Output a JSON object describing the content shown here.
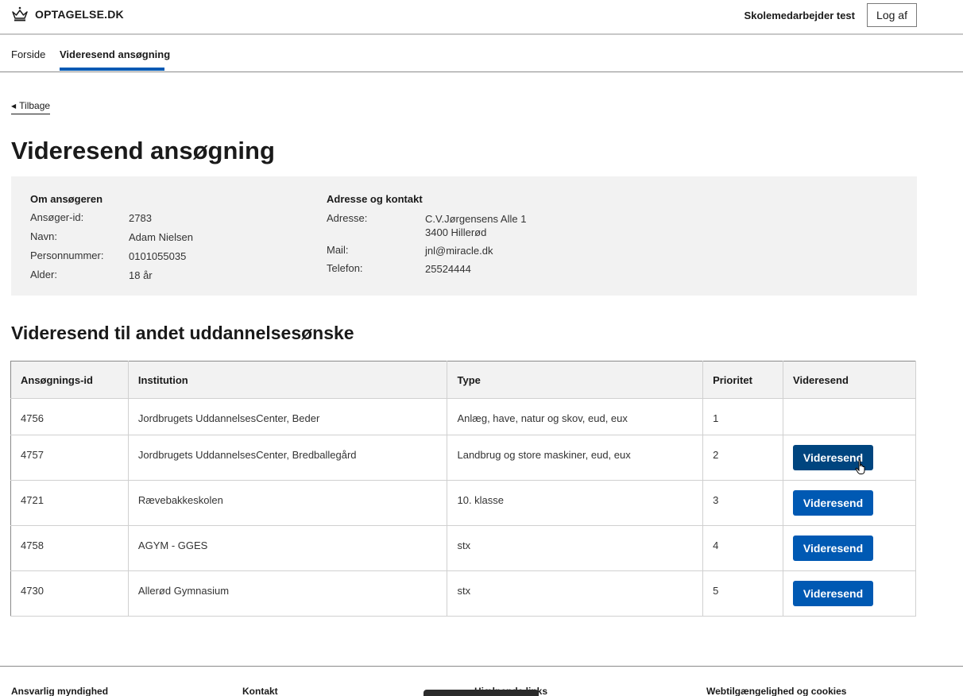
{
  "header": {
    "logo_text": "OPTAGELSE.DK",
    "user_name": "Skolemedarbejder test",
    "logout_label": "Log af"
  },
  "nav": {
    "items": [
      {
        "label": "Forside"
      },
      {
        "label": "Videresend ansøgning"
      }
    ],
    "active_index": 1
  },
  "back_label": "Tilbage",
  "page_title": "Videresend ansøgning",
  "applicant": {
    "heading": "Om ansøgeren",
    "fields": [
      {
        "label": "Ansøger-id:",
        "value": "2783"
      },
      {
        "label": "Navn:",
        "value": "Adam Nielsen"
      },
      {
        "label": "Personnummer:",
        "value": "0101055035"
      },
      {
        "label": "Alder:",
        "value": "18 år"
      }
    ]
  },
  "contact": {
    "heading": "Adresse og kontakt",
    "address_label": "Adresse:",
    "address_line1": "C.V.Jørgensens Alle 1",
    "address_line2": "3400 Hillerød",
    "mail_label": "Mail:",
    "mail_value": "jnl@miracle.dk",
    "phone_label": "Telefon:",
    "phone_value": "25524444"
  },
  "section_title": "Videresend til andet uddannelsesønske",
  "table": {
    "columns": [
      "Ansøgnings-id",
      "Institution",
      "Type",
      "Prioritet",
      "Videresend"
    ],
    "button_label": "Videresend",
    "rows": [
      {
        "id": "4756",
        "institution": "Jordbrugets UddannelsesCenter, Beder",
        "type": "Anlæg, have, natur og skov, eud, eux",
        "priority": "1"
      },
      {
        "id": "4757",
        "institution": "Jordbrugets UddannelsesCenter, Bredballegård",
        "type": "Landbrug og store maskiner, eud, eux",
        "priority": "2"
      },
      {
        "id": "4721",
        "institution": "Rævebakkeskolen",
        "type": "10. klasse",
        "priority": "3"
      },
      {
        "id": "4758",
        "institution": "AGYM - GGES",
        "type": "stx",
        "priority": "4"
      },
      {
        "id": "4730",
        "institution": "Allerød Gymnasium",
        "type": "stx",
        "priority": "5"
      }
    ]
  },
  "footer": {
    "headings": [
      "Ansvarlig myndighed",
      "Kontakt",
      "Hjælpende links",
      "Webtilgængelighed og cookies"
    ]
  },
  "colors": {
    "accent": "#0059b3",
    "button_hover": "#00457f",
    "info_background": "#f2f2f2"
  }
}
